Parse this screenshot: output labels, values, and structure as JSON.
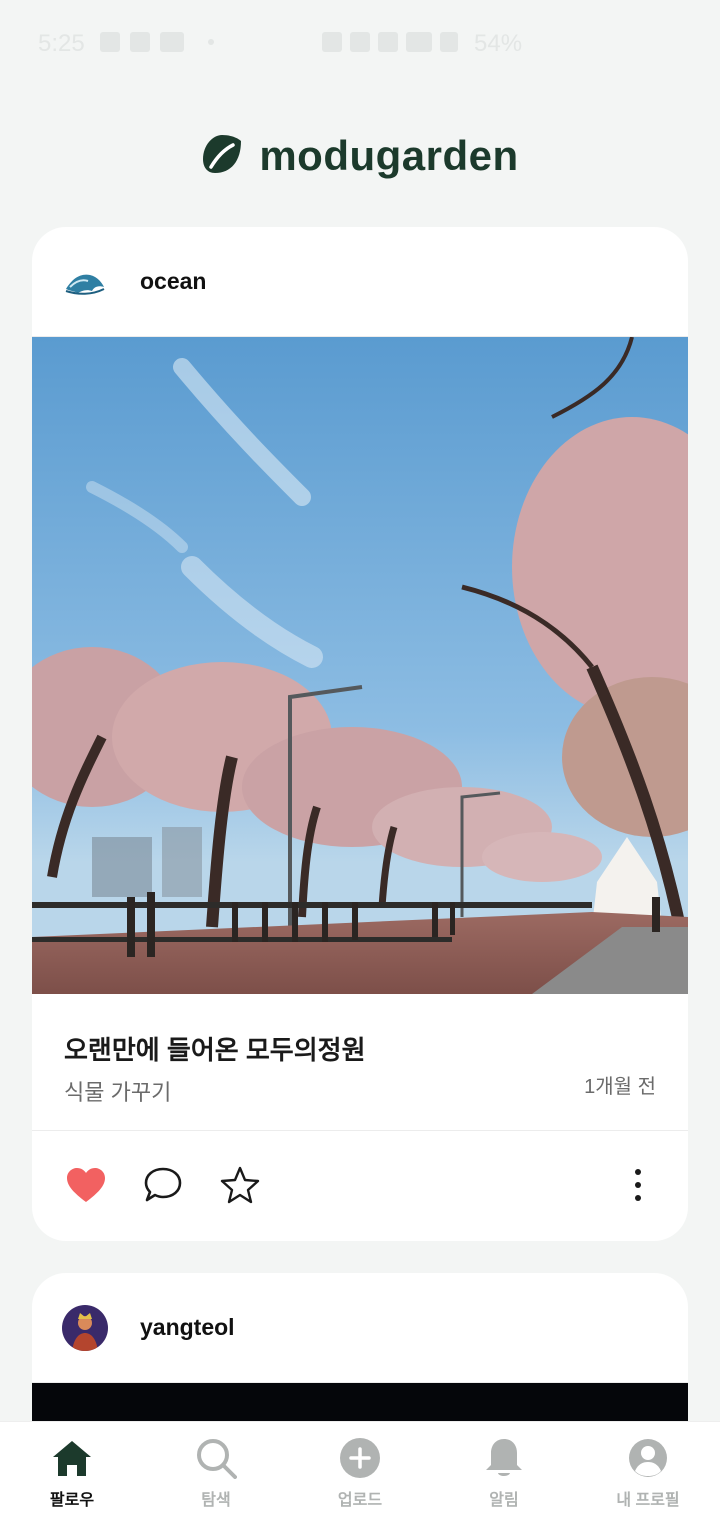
{
  "status_bar": {
    "time": "5:25",
    "battery": "54%"
  },
  "header": {
    "logo_text": "modugarden"
  },
  "posts": [
    {
      "username": "ocean",
      "title": "오랜만에 들어온 모두의정원",
      "category": "식물 가꾸기",
      "time_ago": "1개월 전"
    },
    {
      "username": "yangteol"
    }
  ],
  "bottom_nav": [
    {
      "label": "팔로우",
      "icon": "home-icon",
      "active": true
    },
    {
      "label": "탐색",
      "icon": "search-icon",
      "active": false
    },
    {
      "label": "업로드",
      "icon": "plus-circle-icon",
      "active": false
    },
    {
      "label": "알림",
      "icon": "bell-icon",
      "active": false
    },
    {
      "label": "내 프로필",
      "icon": "profile-icon",
      "active": false
    }
  ],
  "colors": {
    "brand": "#1c3a2c",
    "like": "#f26161",
    "inactive": "#b0b3b2",
    "background": "#f3f5f4"
  }
}
